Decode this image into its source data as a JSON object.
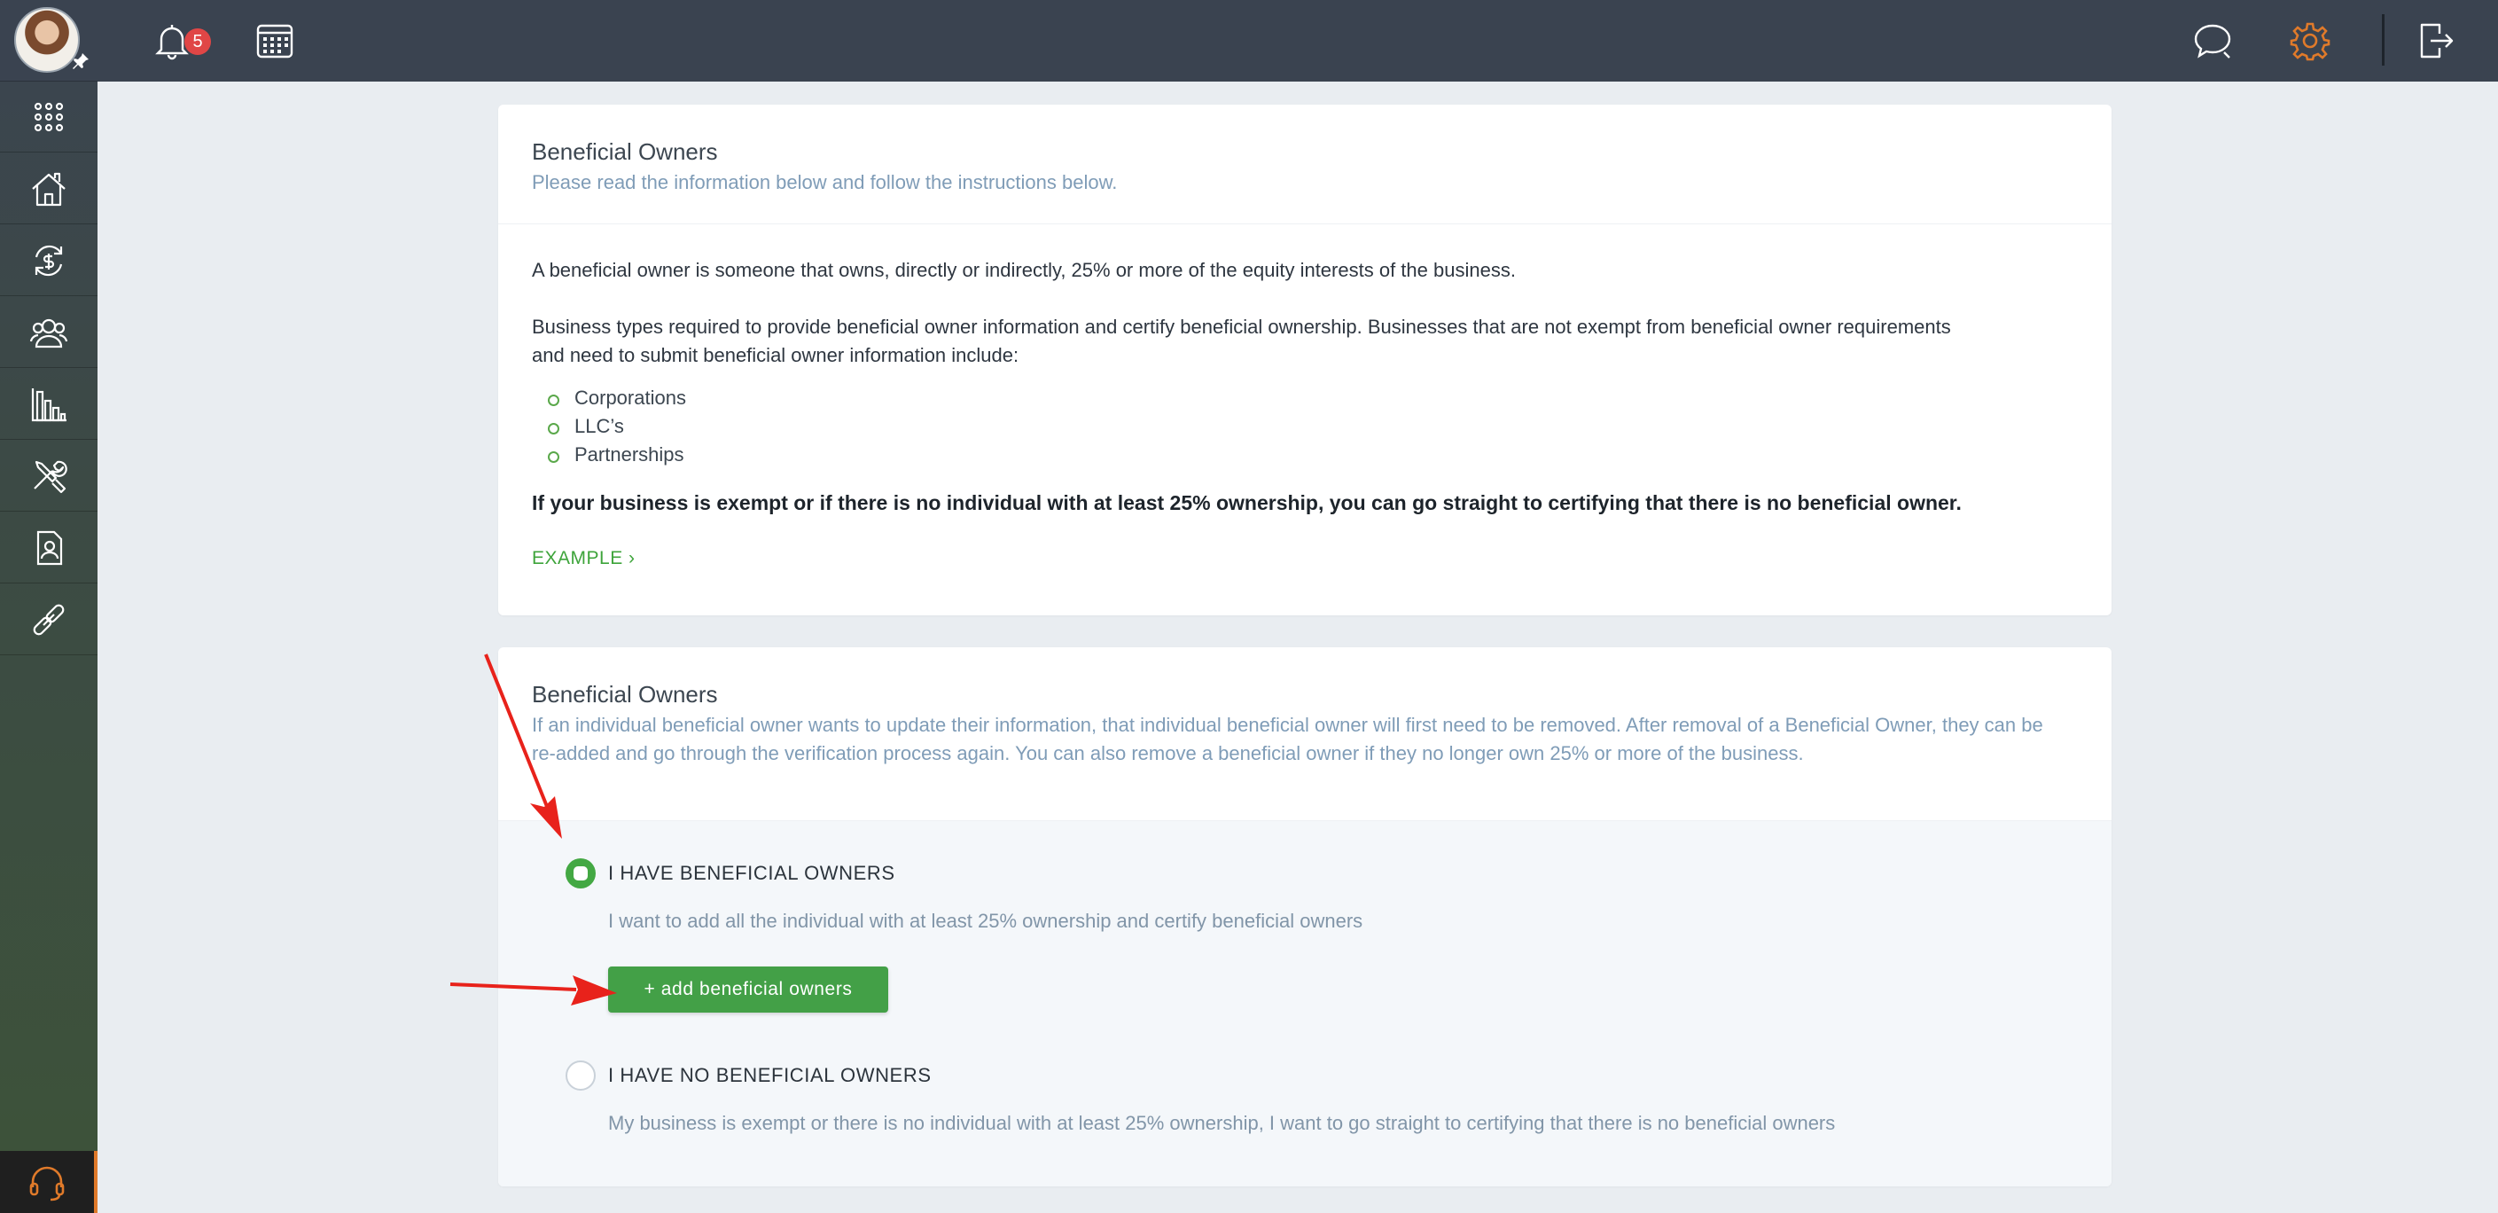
{
  "topbar": {
    "notification_count": "5",
    "icons": [
      "bell-icon",
      "calendar-icon",
      "chat-icon",
      "gear-icon",
      "logout-icon"
    ],
    "accent_color": "#e07a2a"
  },
  "sidebar": {
    "items": [
      "apps-grid-icon",
      "home-icon",
      "exchange-icon",
      "users-icon",
      "bar-chart-icon",
      "tools-icon",
      "contact-card-icon",
      "link-icon"
    ],
    "support_icon": "headset-icon"
  },
  "info_card": {
    "title": "Beneficial Owners",
    "subtitle": "Please read the information below and follow the instructions below.",
    "paragraph1": "A beneficial owner is someone that owns, directly or indirectly, 25% or more of the equity interests of the business.",
    "paragraph2": "Business types required to provide beneficial owner information and certify beneficial ownership. Businesses that are not exempt from beneficial owner requirements and need to submit beneficial owner information include:",
    "bullets": [
      "Corporations",
      "LLC’s",
      "Partnerships"
    ],
    "bold_note": "If your business is exempt or if there is no individual with at least 25% ownership, you can go straight to certifying that there is no beneficial owner.",
    "example_link": "EXAMPLE ›"
  },
  "owners_card": {
    "title": "Beneficial Owners",
    "subtitle": "If an individual beneficial owner wants to update their information, that individual beneficial owner will first need to be removed. After removal of a Beneficial Owner, they can be re-added and go through the verification process again. You can also remove a beneficial owner if they no longer own 25% or more of the business.",
    "option_have": {
      "label": "I HAVE BENEFICIAL OWNERS",
      "description": "I want to add all the individual with at least 25% ownership and certify beneficial owners",
      "selected": true
    },
    "add_button": "+ add beneficial owners",
    "option_none": {
      "label": "I HAVE NO BENEFICIAL OWNERS",
      "description": "My business is exempt or there is no individual with at least 25% ownership, I want to go straight to certifying that there is no beneficial owners",
      "selected": false
    },
    "accent_color": "#43a047"
  }
}
